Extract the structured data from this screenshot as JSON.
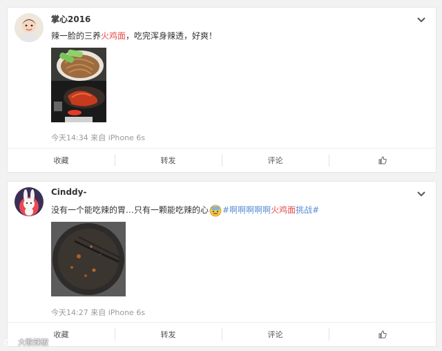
{
  "posts": [
    {
      "username": "掌心2016",
      "text_before": "辣一脸的三养",
      "text_highlight": "火鸡面",
      "text_after": "，吃完浑身辣透，好爽！",
      "meta": "今天14:34 来自 iPhone 6s",
      "actions": {
        "favorite": "收藏",
        "repost": "转发",
        "comment": "评论"
      }
    },
    {
      "username": "Cinddy-",
      "text_before": "没有一个能吃辣的胃…只有一颗能吃辣的心",
      "hashtag_open": "#啊啊啊啊啊",
      "hashtag_highlight": "火鸡面",
      "hashtag_close": "挑战#",
      "meta": "今天14:27 来自 iPhone 6s",
      "actions": {
        "favorite": "收藏",
        "repost": "转发",
        "comment": "评论"
      }
    }
  ],
  "colors": {
    "highlight_red": "#eb4a4a",
    "hashtag_blue": "#5b8dd6"
  },
  "icons": [
    "chevron-down-icon",
    "like-icon",
    "sweat-emoji-icon",
    "weibo-logo-icon"
  ],
  "watermark": {
    "text": "大歌辣椒"
  }
}
